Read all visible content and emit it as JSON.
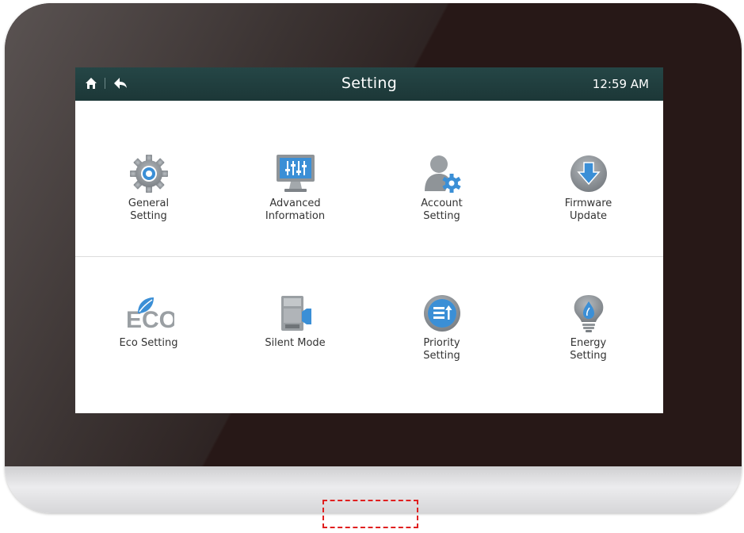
{
  "header": {
    "title": "Setting",
    "time": "12:59 AM"
  },
  "tiles": [
    {
      "label": "General\nSetting",
      "icon": "gear-icon"
    },
    {
      "label": "Advanced\nInformation",
      "icon": "monitor-equalizer-icon"
    },
    {
      "label": "Account\nSetting",
      "icon": "user-settings-icon"
    },
    {
      "label": "Firmware\nUpdate",
      "icon": "download-arrow-icon"
    },
    {
      "label": "Eco Setting",
      "icon": "eco-leaf-icon"
    },
    {
      "label": "Silent Mode",
      "icon": "silent-unit-icon"
    },
    {
      "label": "Priority\nSetting",
      "icon": "priority-list-icon"
    },
    {
      "label": "Energy\nSetting",
      "icon": "energy-bulb-icon"
    }
  ],
  "colors": {
    "titlebar": "#1f3d3d",
    "bezel": "#271817",
    "icon_gray": "#8f9498",
    "icon_blue": "#3b8fd6",
    "indicator": "#e02020"
  }
}
